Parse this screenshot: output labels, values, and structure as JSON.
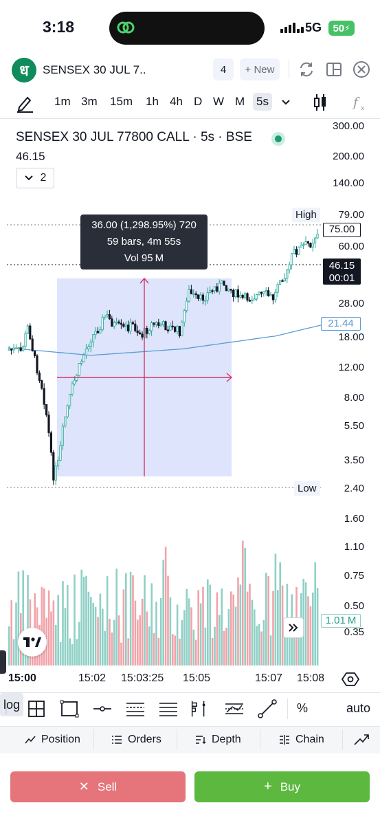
{
  "status_bar": {
    "time": "3:18",
    "network": "5G",
    "battery": "50"
  },
  "header": {
    "logo_glyph": "ध",
    "symbol_title": "SENSEX 30 JUL 7..",
    "tab_count": "4",
    "new_label": "+ New"
  },
  "intervals": [
    {
      "label": "1m",
      "active": false
    },
    {
      "label": "3m",
      "active": false
    },
    {
      "label": "15m",
      "active": false
    },
    {
      "label": "1h",
      "active": false
    },
    {
      "label": "4h",
      "active": false
    },
    {
      "label": "D",
      "active": false
    },
    {
      "label": "W",
      "active": false
    },
    {
      "label": "M",
      "active": false
    },
    {
      "label": "5s",
      "active": true
    }
  ],
  "legend": {
    "title": "SENSEX 30 JUL 77800 CALL · 5s · BSE",
    "price": "46.15",
    "indicator_count": "2"
  },
  "tooltip": {
    "line1": "36.00 (1,298.95%) 720",
    "line2": "59 bars, 4m 55s",
    "line3": "Vol 95 M"
  },
  "price_scale": {
    "labels": [
      "300.00",
      "200.00",
      "140.00",
      "60.00",
      "28.00",
      "18.00",
      "12.00",
      "8.00",
      "5.50",
      "3.50",
      "1.60",
      "1.10",
      "0.75",
      "0.50",
      "0.35"
    ],
    "high_tag": "High",
    "high_value": "79.00",
    "boxed_value": "75.00",
    "last_price": "46.15",
    "countdown": "00:01",
    "ma_value": "21.44",
    "low_tag": "Low",
    "low_value": "2.40",
    "volume_value": "1.01 M"
  },
  "time_scale": [
    "15:00",
    "15:02",
    "15:03:25",
    "15:05",
    "15:07",
    "15:08"
  ],
  "colors": {
    "up": "#26a69a",
    "down": "#131722",
    "ma": "#5b9bd5",
    "range_fill": "#dde4fb",
    "range_line": "#d6336c",
    "vol_up": "#8fd0c6",
    "vol_down": "#f2a3a9"
  },
  "tools": {
    "percent_label": "%",
    "log_label": "log",
    "auto_label": "auto"
  },
  "bottom_tabs": [
    {
      "label": "Position",
      "icon": "position-icon"
    },
    {
      "label": "Orders",
      "icon": "orders-icon"
    },
    {
      "label": "Depth",
      "icon": "depth-icon"
    },
    {
      "label": "Chain",
      "icon": "chain-icon"
    }
  ],
  "actions": {
    "sell_label": "Sell",
    "buy_label": "Buy"
  }
}
